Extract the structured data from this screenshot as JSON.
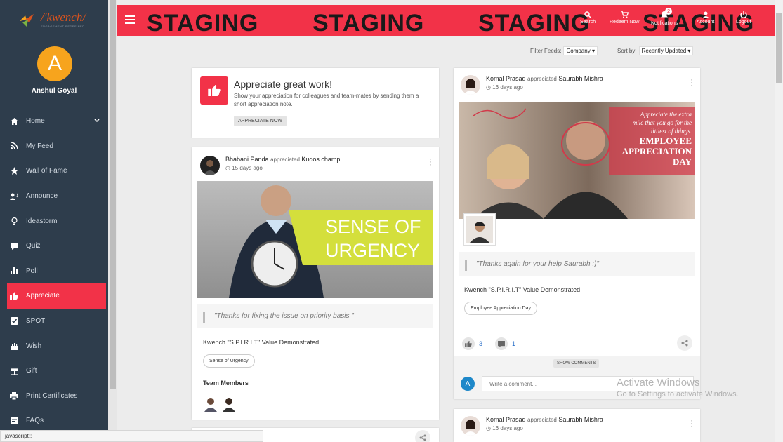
{
  "brand": {
    "logo_text": "/'kwench/",
    "logo_sub": "ENGAGEMENT REDEFINED"
  },
  "user": {
    "initial": "A",
    "name": "Anshul Goyal"
  },
  "menu": [
    {
      "label": "Home"
    },
    {
      "label": "My Feed"
    },
    {
      "label": "Wall of Fame"
    },
    {
      "label": "Announce"
    },
    {
      "label": "Ideastorm"
    },
    {
      "label": "Quiz"
    },
    {
      "label": "Poll"
    },
    {
      "label": "Appreciate"
    },
    {
      "label": "SPOT"
    },
    {
      "label": "Wish"
    },
    {
      "label": "Gift"
    },
    {
      "label": "Print Certificates"
    },
    {
      "label": "FAQs"
    }
  ],
  "topbar": {
    "staging": "STAGING",
    "search": "Search",
    "redeem": "Redeem Now",
    "notifications": "Notifications",
    "notif_count": "2",
    "account": "Account",
    "logout": "Logout"
  },
  "filters": {
    "filter_label": "Filter Feeds:",
    "filter_value": "Company",
    "sort_label": "Sort by:",
    "sort_value": "Recently Updated"
  },
  "appreciate_card": {
    "title": "Appreciate great work!",
    "desc": "Show your appreciation for colleagues and team-mates by sending them a short appreciation note.",
    "button": "APPRECIATE NOW"
  },
  "post1": {
    "author": "Bhabani Panda",
    "verb": "appreciated",
    "target": "Kudos champ",
    "date": "15 days ago",
    "banner_l1": "SENSE OF",
    "banner_l2": "URGENCY",
    "quote": "\"Thanks for fixing the issue on priority basis.\"",
    "value": "Kwench \"S.P.I.R.I.T\" Value Demonstrated",
    "tag": "Sense of Urgency",
    "team_label": "Team Members"
  },
  "post2": {
    "author": "Komal Prasad",
    "verb": "appreciated",
    "target": "Saurabh Mishra",
    "date": "16 days ago",
    "img_l1": "Appreciate the extra",
    "img_l2": "mile that you go for the",
    "img_l3": "littlest of things.",
    "img_l4": "EMPLOYEE",
    "img_l5": "APPRECIATION",
    "img_l6": "DAY",
    "quote": "\"Thanks again for your help Saurabh :)\"",
    "value": "Kwench \"S.P.I.R.I.T\" Value Demonstrated",
    "tag": "Employee Appreciation Day",
    "likes": "3",
    "comments": "1",
    "show_comments": "SHOW COMMENTS",
    "comment_avatar": "A",
    "comment_placeholder": "Write a comment..."
  },
  "post3": {
    "author": "Komal Prasad",
    "verb": "appreciated",
    "target": "Saurabh Mishra",
    "date": "16 days ago"
  },
  "status_bar": "javascript:;",
  "watermark": {
    "l1": "Activate Windows",
    "l2": "Go to Settings to activate Windows."
  }
}
